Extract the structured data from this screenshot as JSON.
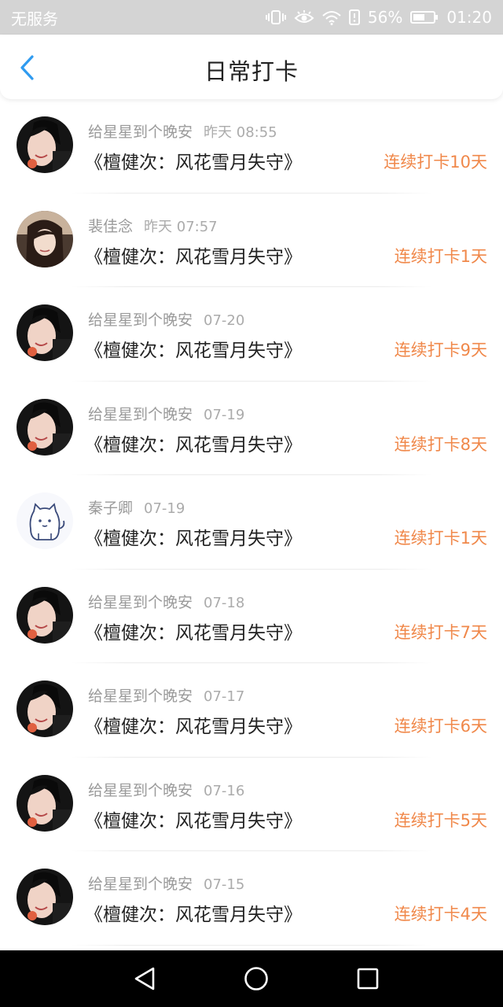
{
  "status_bar": {
    "carrier": "无服务",
    "battery_percent": "56%",
    "time": "01:20",
    "icons": [
      "vibrate-icon",
      "eye-comfort-icon",
      "wifi-icon",
      "battery-alert-icon",
      "battery-icon"
    ]
  },
  "header": {
    "title": "日常打卡",
    "back_icon": "chevron-left-icon",
    "accent_color": "#2f9bf0"
  },
  "list": {
    "items": [
      {
        "avatar": "avatar-photo-girl",
        "name": "给星星到个晚安",
        "time": "昨天 08:55",
        "book": "《檀健次：风花雪月失守》",
        "streak": "连续打卡10天"
      },
      {
        "avatar": "avatar-photo-girl-2",
        "name": "裴佳念",
        "time": "昨天 07:57",
        "book": "《檀健次：风花雪月失守》",
        "streak": "连续打卡1天"
      },
      {
        "avatar": "avatar-photo-girl",
        "name": "给星星到个晚安",
        "time": "07-20",
        "book": "《檀健次：风花雪月失守》",
        "streak": "连续打卡9天"
      },
      {
        "avatar": "avatar-photo-girl",
        "name": "给星星到个晚安",
        "time": "07-19",
        "book": "《檀健次：风花雪月失守》",
        "streak": "连续打卡8天"
      },
      {
        "avatar": "avatar-cartoon-cat",
        "name": "秦子卿",
        "time": "07-19",
        "book": "《檀健次：风花雪月失守》",
        "streak": "连续打卡1天"
      },
      {
        "avatar": "avatar-photo-girl",
        "name": "给星星到个晚安",
        "time": "07-18",
        "book": "《檀健次：风花雪月失守》",
        "streak": "连续打卡7天"
      },
      {
        "avatar": "avatar-photo-girl",
        "name": "给星星到个晚安",
        "time": "07-17",
        "book": "《檀健次：风花雪月失守》",
        "streak": "连续打卡6天"
      },
      {
        "avatar": "avatar-photo-girl",
        "name": "给星星到个晚安",
        "time": "07-16",
        "book": "《檀健次：风花雪月失守》",
        "streak": "连续打卡5天"
      },
      {
        "avatar": "avatar-photo-girl",
        "name": "给星星到个晚安",
        "time": "07-15",
        "book": "《檀健次：风花雪月失守》",
        "streak": "连续打卡4天"
      }
    ]
  },
  "colors": {
    "streak": "#f0884a",
    "title": "#222222",
    "meta": "#9b9b9b"
  },
  "nav_bar": {
    "icons": [
      "back-triangle-icon",
      "home-circle-icon",
      "recents-square-icon"
    ]
  }
}
